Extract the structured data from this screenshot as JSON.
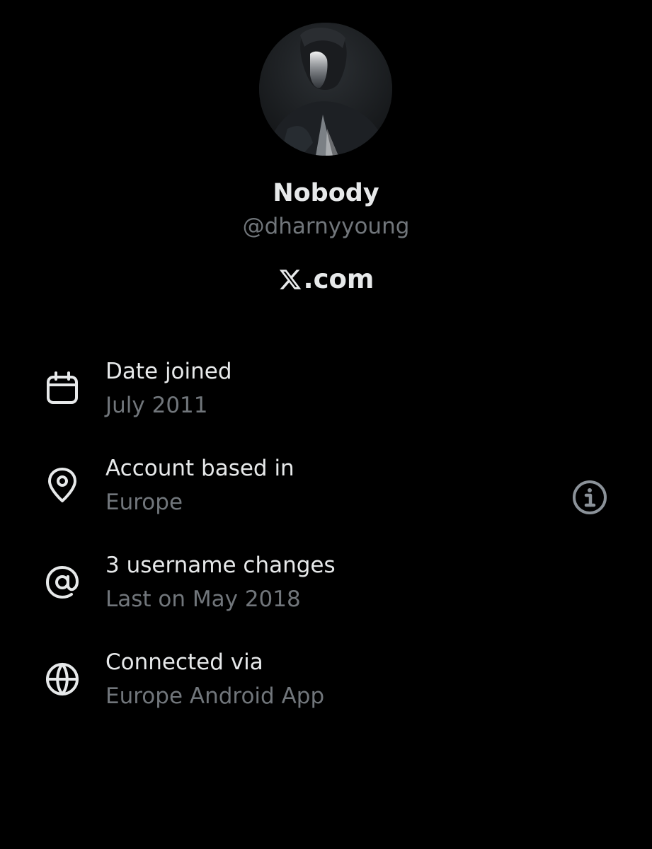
{
  "profile": {
    "display_name": "Nobody",
    "handle": "@dharnyyoung",
    "brand_text": ".com",
    "avatar_icon": "profile-photo"
  },
  "details": [
    {
      "icon": "calendar-icon",
      "title": "Date joined",
      "subtitle": "July 2011"
    },
    {
      "icon": "location-pin-icon",
      "title": "Account based in",
      "subtitle": "Europe",
      "action_icon": "info-icon"
    },
    {
      "icon": "at-sign-icon",
      "title": "3 username changes",
      "subtitle": "Last on May 2018"
    },
    {
      "icon": "globe-icon",
      "title": "Connected via",
      "subtitle": "Europe Android App"
    }
  ],
  "colors": {
    "background": "#000000",
    "primary_text": "#e7e9ea",
    "secondary_text": "#71767b"
  }
}
